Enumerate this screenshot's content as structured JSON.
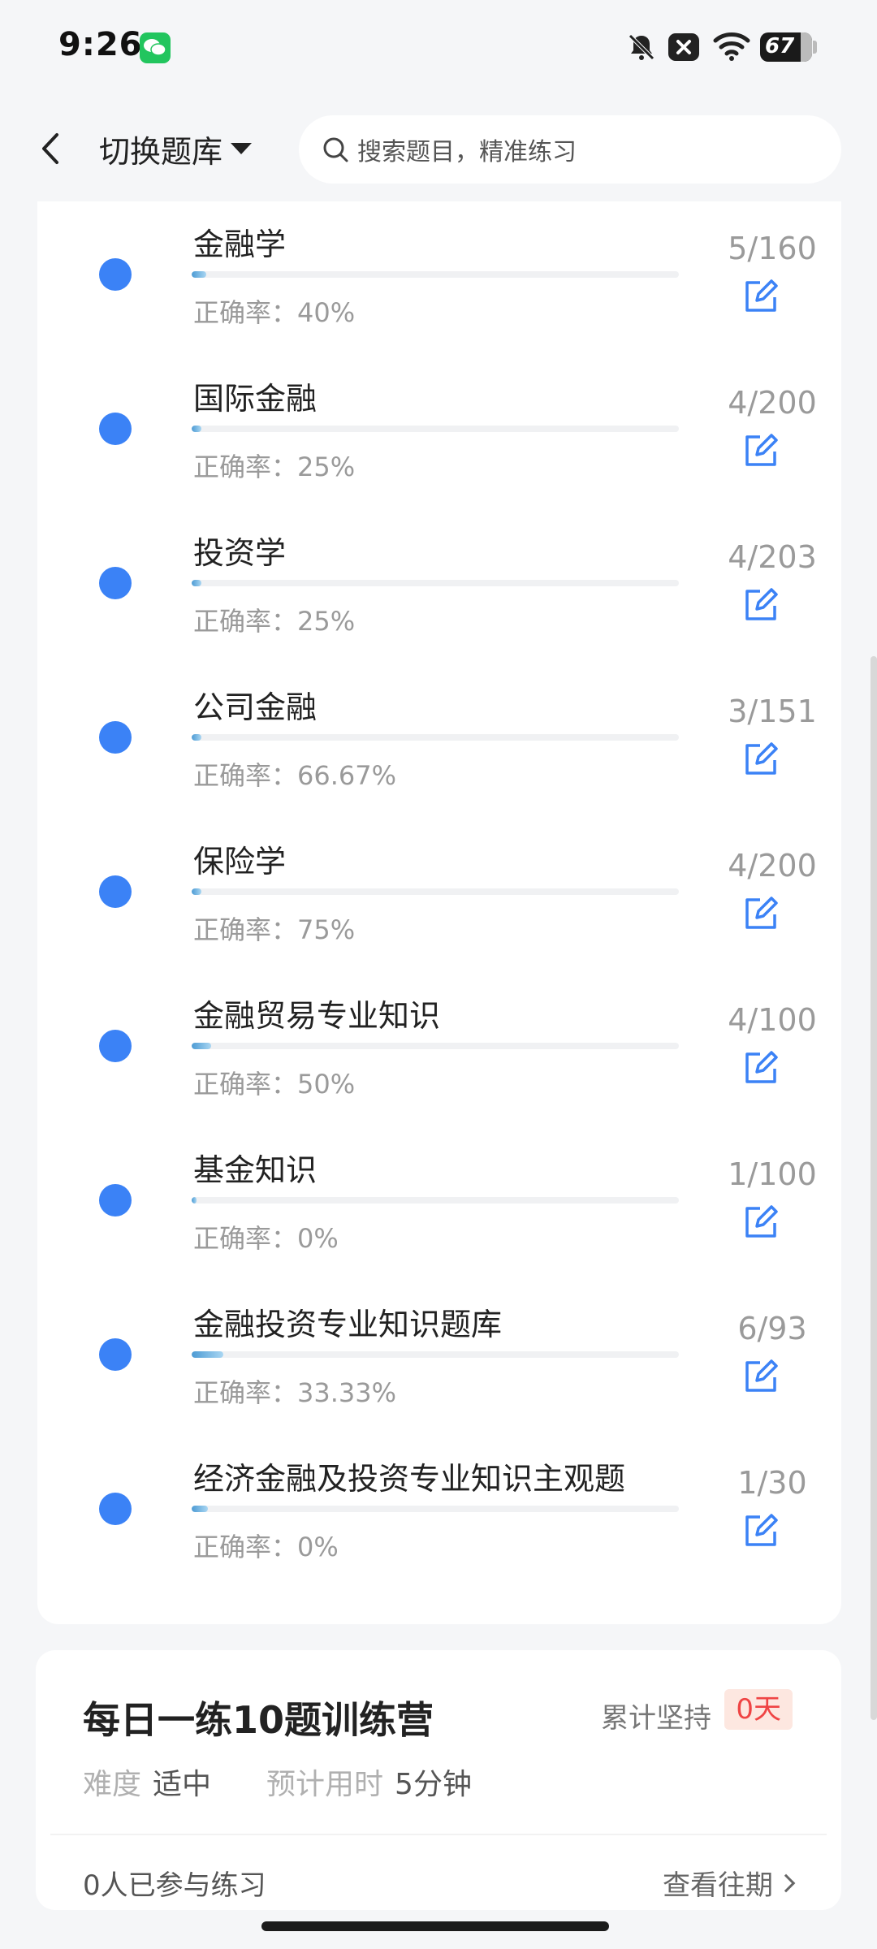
{
  "status_bar": {
    "time": "9:26",
    "battery": "67",
    "icons": [
      "wechat-icon",
      "bell-off-icon",
      "close-box-icon",
      "wifi-icon",
      "battery-icon"
    ]
  },
  "header": {
    "switch_label": "切换题库",
    "search_placeholder": "搜索题目，精准练习"
  },
  "subjects": [
    {
      "title": "金融学",
      "accuracy": "正确率：40%",
      "count": "5/160",
      "progress": 0.03
    },
    {
      "title": "国际金融",
      "accuracy": "正确率：25%",
      "count": "4/200",
      "progress": 0.02
    },
    {
      "title": "投资学",
      "accuracy": "正确率：25%",
      "count": "4/203",
      "progress": 0.02
    },
    {
      "title": "公司金融",
      "accuracy": "正确率：66.67%",
      "count": "3/151",
      "progress": 0.02
    },
    {
      "title": "保险学",
      "accuracy": "正确率：75%",
      "count": "4/200",
      "progress": 0.02
    },
    {
      "title": "金融贸易专业知识",
      "accuracy": "正确率：50%",
      "count": "4/100",
      "progress": 0.04
    },
    {
      "title": "基金知识",
      "accuracy": "正确率：0%",
      "count": "1/100",
      "progress": 0.01
    },
    {
      "title": "金融投资专业知识题库",
      "accuracy": "正确率：33.33%",
      "count": "6/93",
      "progress": 0.065
    },
    {
      "title": "经济金融及投资专业知识主观题",
      "accuracy": "正确率：0%",
      "count": "1/30",
      "progress": 0.033
    }
  ],
  "daily": {
    "title": "每日一练10题训练营",
    "streak_label": "累计坚持",
    "streak_value": "0天",
    "difficulty_label": "难度",
    "difficulty_value": "适中",
    "time_label": "预计用时",
    "time_value": "5分钟",
    "participants": "0人已参与练习",
    "history_link": "查看往期"
  },
  "colors": {
    "accent": "#3b82f6",
    "badge_bg": "#fde7e0",
    "badge_text": "#ef4444"
  }
}
